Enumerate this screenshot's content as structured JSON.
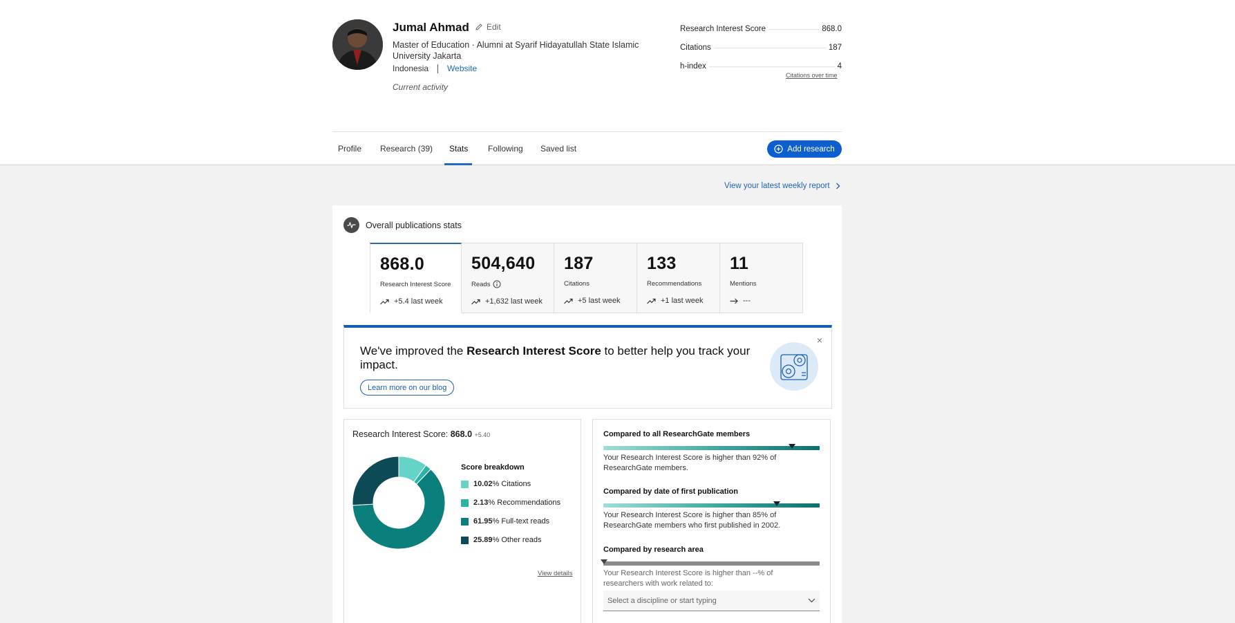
{
  "profile": {
    "name": "Jumal Ahmad",
    "edit_label": "Edit",
    "degree": "Master of Education · Alumni at Syarif Hidayatullah State Islamic University Jakarta",
    "country": "Indonesia",
    "website_label": "Website",
    "activity_label": "Current activity"
  },
  "metrics": {
    "items": [
      {
        "label": "Research Interest Score",
        "value": "868.0"
      },
      {
        "label": "Citations",
        "value": "187"
      },
      {
        "label": "h-index",
        "value": "4"
      }
    ],
    "citations_over_time_link": "Citations over time"
  },
  "tabs": [
    {
      "label": "Profile"
    },
    {
      "label": "Research (39)"
    },
    {
      "label": "Stats",
      "active": true
    },
    {
      "label": "Following"
    },
    {
      "label": "Saved list"
    }
  ],
  "add_research_label": "Add research",
  "weekly_report_link": "View your latest weekly report",
  "overview": {
    "title": "Overall publications stats",
    "stats": [
      {
        "value": "868.0",
        "label": "Research Interest Score",
        "change": "+5.4 last week",
        "trend": "up",
        "active": true
      },
      {
        "value": "504,640",
        "label": "Reads",
        "change": "+1,632 last week",
        "trend": "up"
      },
      {
        "value": "187",
        "label": "Citations",
        "change": "+5 last week",
        "trend": "up"
      },
      {
        "value": "133",
        "label": "Recommendations",
        "change": "+1 last week",
        "trend": "up"
      },
      {
        "value": "11",
        "label": "Mentions",
        "change": "---",
        "trend": "flat"
      }
    ]
  },
  "banner": {
    "text_pre": "We've improved the ",
    "text_bold": "Research Interest Score",
    "text_post": " to better help you track your impact.",
    "learn_label": "Learn more on our blog",
    "close_glyph": "×"
  },
  "ris_panel": {
    "title_prefix": "Research Interest Score: ",
    "value": "868.0",
    "increment": "+5.40",
    "breakdown_title": "Score breakdown",
    "legend": [
      {
        "pct": "10.02",
        "suffix": "% Citations",
        "color": "#66d3c8"
      },
      {
        "pct": "2.13",
        "suffix": "% Recommendations",
        "color": "#2bb3a8"
      },
      {
        "pct": "61.95",
        "suffix": "% Full-text reads",
        "color": "#0b7f7b"
      },
      {
        "pct": "25.89",
        "suffix": "% Other reads",
        "color": "#0e4a55"
      }
    ],
    "view_details_link": "View details"
  },
  "comparisons": {
    "all_members": {
      "heading": "Compared to all ResearchGate members",
      "text": "Your Research Interest Score is higher than 92% of ResearchGate members.",
      "percentile": 92
    },
    "first_publication": {
      "heading": "Compared by date of first publication",
      "text": "Your Research Interest Score is higher than 85% of ResearchGate members who first published in 2002.",
      "percentile": 85
    },
    "research_area": {
      "heading": "Compared by research area",
      "text": "Your Research Interest Score is higher than --% of researchers with work related to:",
      "select_placeholder": "Select a discipline or start typing"
    }
  }
}
